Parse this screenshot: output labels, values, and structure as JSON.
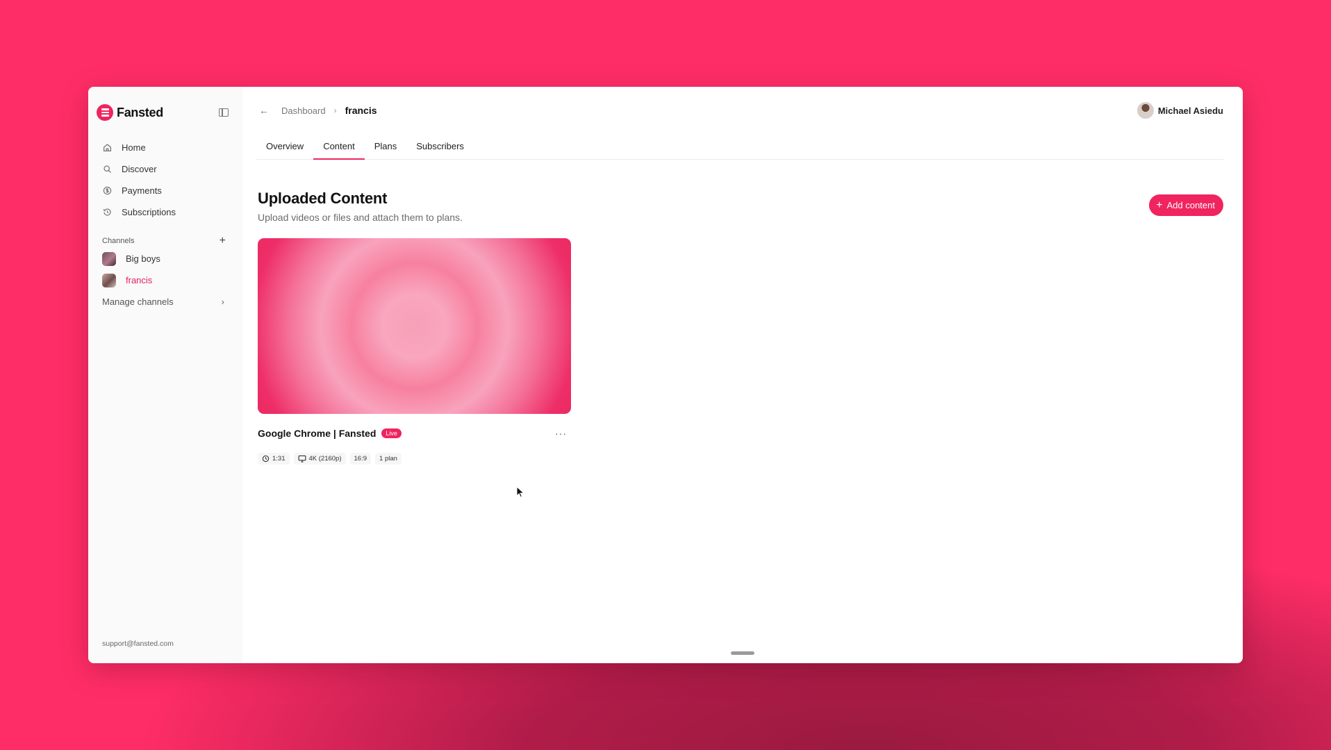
{
  "brand": {
    "name": "Fansted",
    "accent": "#f0245f"
  },
  "sidebar": {
    "nav": [
      {
        "label": "Home",
        "icon": "home-icon"
      },
      {
        "label": "Discover",
        "icon": "search-icon"
      },
      {
        "label": "Payments",
        "icon": "dollar-icon"
      },
      {
        "label": "Subscriptions",
        "icon": "history-icon"
      }
    ],
    "channels_label": "Channels",
    "channels": [
      {
        "label": "Big boys"
      },
      {
        "label": "francis"
      }
    ],
    "manage_label": "Manage channels",
    "support_email": "support@fansted.com"
  },
  "topbar": {
    "breadcrumb_parent": "Dashboard",
    "breadcrumb_current": "francis",
    "user_name": "Michael Asiedu"
  },
  "tabs": [
    {
      "label": "Overview"
    },
    {
      "label": "Content"
    },
    {
      "label": "Plans"
    },
    {
      "label": "Subscribers"
    }
  ],
  "content": {
    "title": "Uploaded Content",
    "subtitle": "Upload videos or files and attach them to plans.",
    "add_label": "Add content",
    "card": {
      "title": "Google Chrome | Fansted",
      "status": "Live",
      "duration": "1:31",
      "resolution": "4K (2160p)",
      "aspect": "16:9",
      "plans": "1 plan"
    }
  }
}
